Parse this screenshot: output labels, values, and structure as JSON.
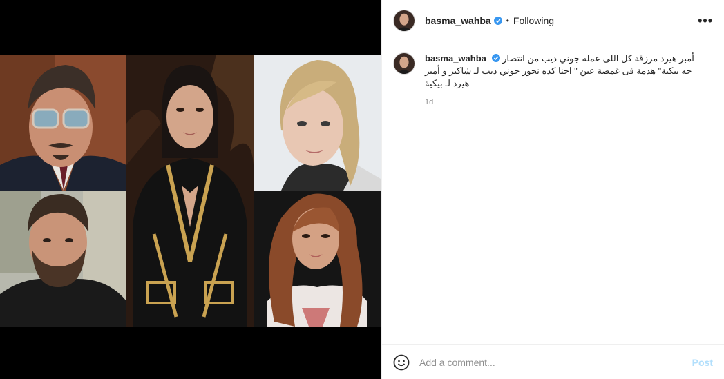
{
  "post": {
    "username": "basma_wahba",
    "follow_status": "Following",
    "more_label": "•••",
    "separator": "•",
    "caption": "أمبر هيرد مرزقة كل اللى عمله جوني ديب من انتصار جه بيكية\" هدمة فى غمضة عين \" احنا كده نجوز جوني ديب لـ شاكير و أمبر هيرد لـ بيكية",
    "time": "1d"
  },
  "composer": {
    "placeholder": "Add a comment...",
    "post_label": "Post"
  },
  "colors": {
    "verified": "#3897f0",
    "post_disabled": "#b2dffc"
  }
}
